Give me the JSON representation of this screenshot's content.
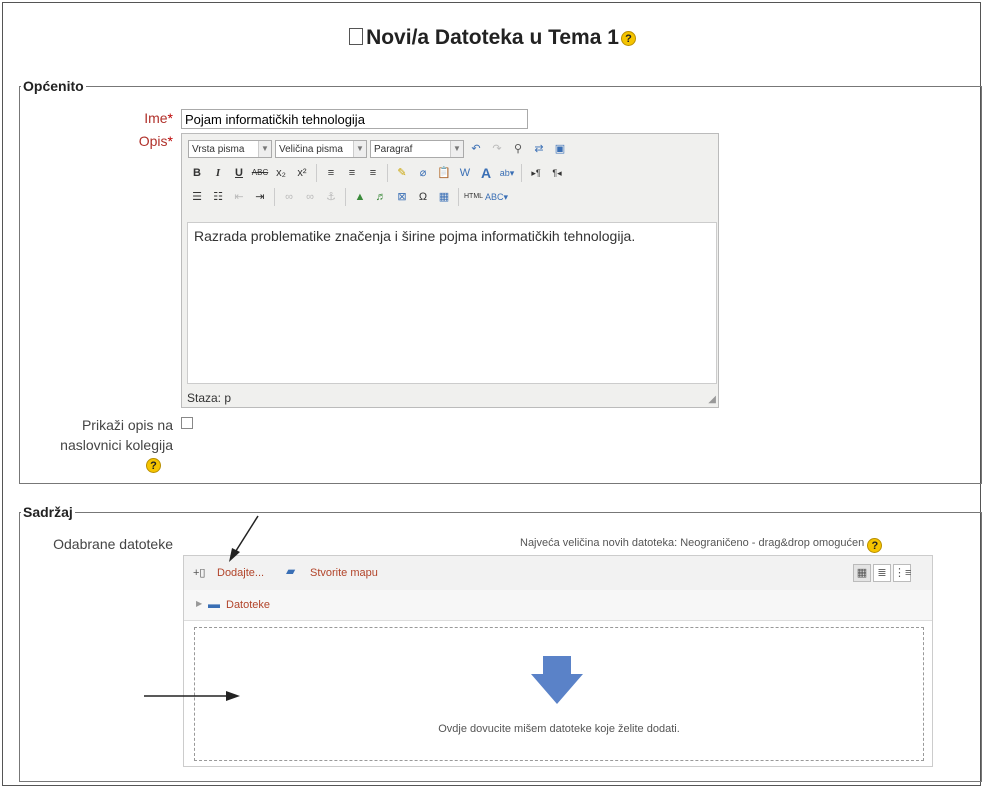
{
  "page_title": "Novi/a Datoteka u Tema 1",
  "general": {
    "legend": "Općenito",
    "name_label": "Ime",
    "name_value": "Pojam informatičkih tehnologija",
    "desc_label": "Opis",
    "editor": {
      "font_family": "Vrsta pisma",
      "font_size": "Veličina pisma",
      "paragraph": "Paragraf",
      "content": "Razrada problematike značenja i širine pojma informatičkih tehnologija.",
      "status": "Staza: p"
    },
    "show_desc_label": "Prikaži opis na naslovnici kolegija",
    "required_mark": "*"
  },
  "content": {
    "legend": "Sadržaj",
    "files_label": "Odabrane datoteke",
    "limit_text": "Najveća veličina novih datoteka: Neograničeno - drag&drop omogućen",
    "add_label": "Dodajte...",
    "create_folder_label": "Stvorite mapu",
    "path_label": "Datoteke",
    "drop_text": "Ovdje dovucite mišem datoteke koje želite dodati."
  },
  "colors": {
    "required": "#b0302a",
    "link": "#b2442a",
    "arrow": "#5a82c8",
    "help": "#f5c400"
  }
}
